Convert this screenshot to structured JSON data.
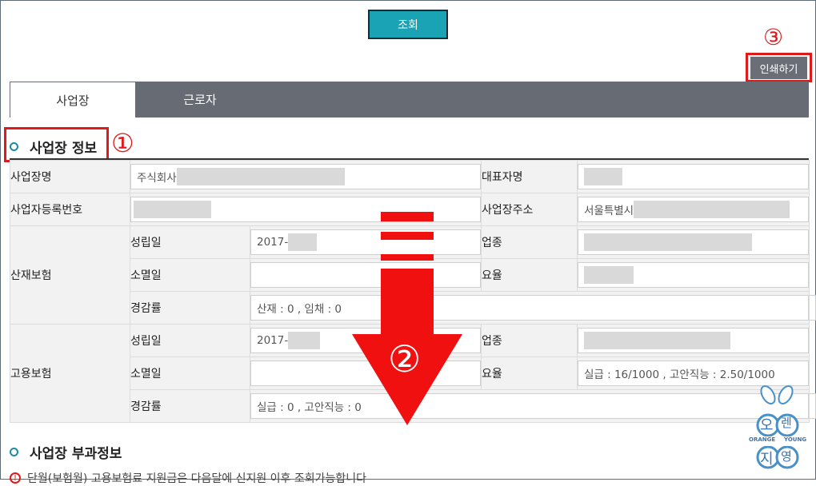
{
  "toolbar": {
    "search_label": "조회",
    "print_label": "인쇄하기"
  },
  "tabs": [
    {
      "label": "사업장"
    },
    {
      "label": "근로자"
    }
  ],
  "sections": {
    "business_info": "사업장 정보",
    "business_extra": "사업장 부과정보"
  },
  "table": {
    "business_name_label": "사업장명",
    "business_name_value": "주식회사",
    "representative_label": "대표자명",
    "reg_no_label": "사업자등록번호",
    "address_label": "사업장주소",
    "address_value": "서울특별시",
    "industrial": {
      "group_label": "산재보험",
      "established_label": "성립일",
      "established_value": "2017-",
      "industry_label": "업종",
      "closed_label": "소멸일",
      "rate_label": "요율",
      "reduction_label": "경감률",
      "reduction_value": "산재 : 0 ,  임채 : 0"
    },
    "employment": {
      "group_label": "고용보험",
      "established_label": "성립일",
      "established_value": "2017-",
      "industry_label": "업종",
      "closed_label": "소멸일",
      "rate_label": "요율",
      "rate_value": "실급 : 16/1000 ,  고안직능 : 2.50/1000",
      "reduction_label": "경감률",
      "reduction_value": "실급 : 0 ,  고안직능 : 0"
    }
  },
  "notice": "단월(보험월) 고용보험료 지원금은 다음달에 신지원 이후 조회가능합니다",
  "annotations": {
    "one": "①",
    "two": "②",
    "three": "③"
  },
  "logo": {
    "top": "오",
    "top2": "렌",
    "bottom": "지",
    "bottom2": "영",
    "left_text": "ORANGE",
    "right_text": "YOUNG"
  },
  "colors": {
    "accent": "#1aa3b5",
    "annotation": "#e01a1a",
    "tab_bar": "#676c74"
  }
}
